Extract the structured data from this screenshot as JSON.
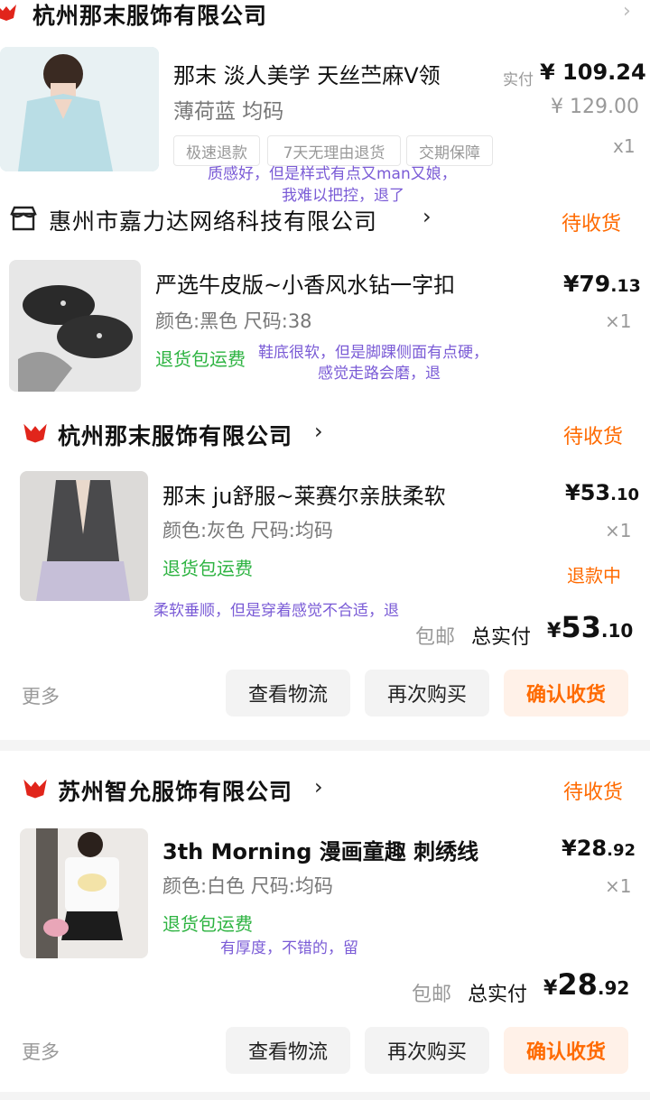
{
  "order1": {
    "shop": "杭州那末服饰有限公司",
    "title": "那末 淡人美学 天丝苎麻V领",
    "spec": "薄荷蓝 均码",
    "paid_label": "实付",
    "paid_price": "¥ 109.24",
    "orig_price": "¥ 129.00",
    "qty": "x1",
    "tags": [
      "极速退款",
      "7天无理由退货",
      "交期保障"
    ],
    "note_l1": "质感好，但是样式有点又man又娘，",
    "note_l2": "我难以把控，退了"
  },
  "order2": {
    "shop": "惠州市嘉力达网络科技有限公司",
    "status": "待收货",
    "title": "严选牛皮版~小香风水钻一字扣",
    "spec": "颜色:黑色 尺码:38",
    "price_int": "¥79",
    "price_dec": ".13",
    "qty": "×1",
    "badge": "退货包运费",
    "note_l1": "鞋底很软，但是脚踝侧面有点硬，",
    "note_l2": "感觉走路会磨，退"
  },
  "order3": {
    "shop": "杭州那末服饰有限公司",
    "status": "待收货",
    "title": "那末 ju舒服~莱赛尔亲肤柔软",
    "spec": "颜色:灰色 尺码:均码",
    "price_int": "¥53",
    "price_dec": ".10",
    "qty": "×1",
    "badge": "退货包运费",
    "refund": "退款中",
    "note": "柔软垂顺，但是穿着感觉不合适，退",
    "free_ship": "包邮",
    "total_label": "总实付",
    "total_yen": "¥",
    "total_int": "53",
    "total_dec": ".10",
    "more": "更多",
    "btn_logistics": "查看物流",
    "btn_rebuy": "再次购买",
    "btn_confirm": "确认收货"
  },
  "order4": {
    "shop": "苏州智允服饰有限公司",
    "status": "待收货",
    "title": "3th Morning 漫画童趣 刺绣线",
    "spec": "颜色:白色 尺码:均码",
    "price_int": "¥28",
    "price_dec": ".92",
    "qty": "×1",
    "badge": "退货包运费",
    "note": "有厚度，不错的，留",
    "free_ship": "包邮",
    "total_label": "总实付",
    "total_yen": "¥",
    "total_int": "28",
    "total_dec": ".92",
    "more": "更多",
    "btn_logistics": "查看物流",
    "btn_rebuy": "再次购买",
    "btn_confirm": "确认收货"
  },
  "colors": {
    "accent": "#ff6a00",
    "green": "#2db341",
    "note": "#7a5bd6",
    "brand_red": "#e1251b"
  }
}
